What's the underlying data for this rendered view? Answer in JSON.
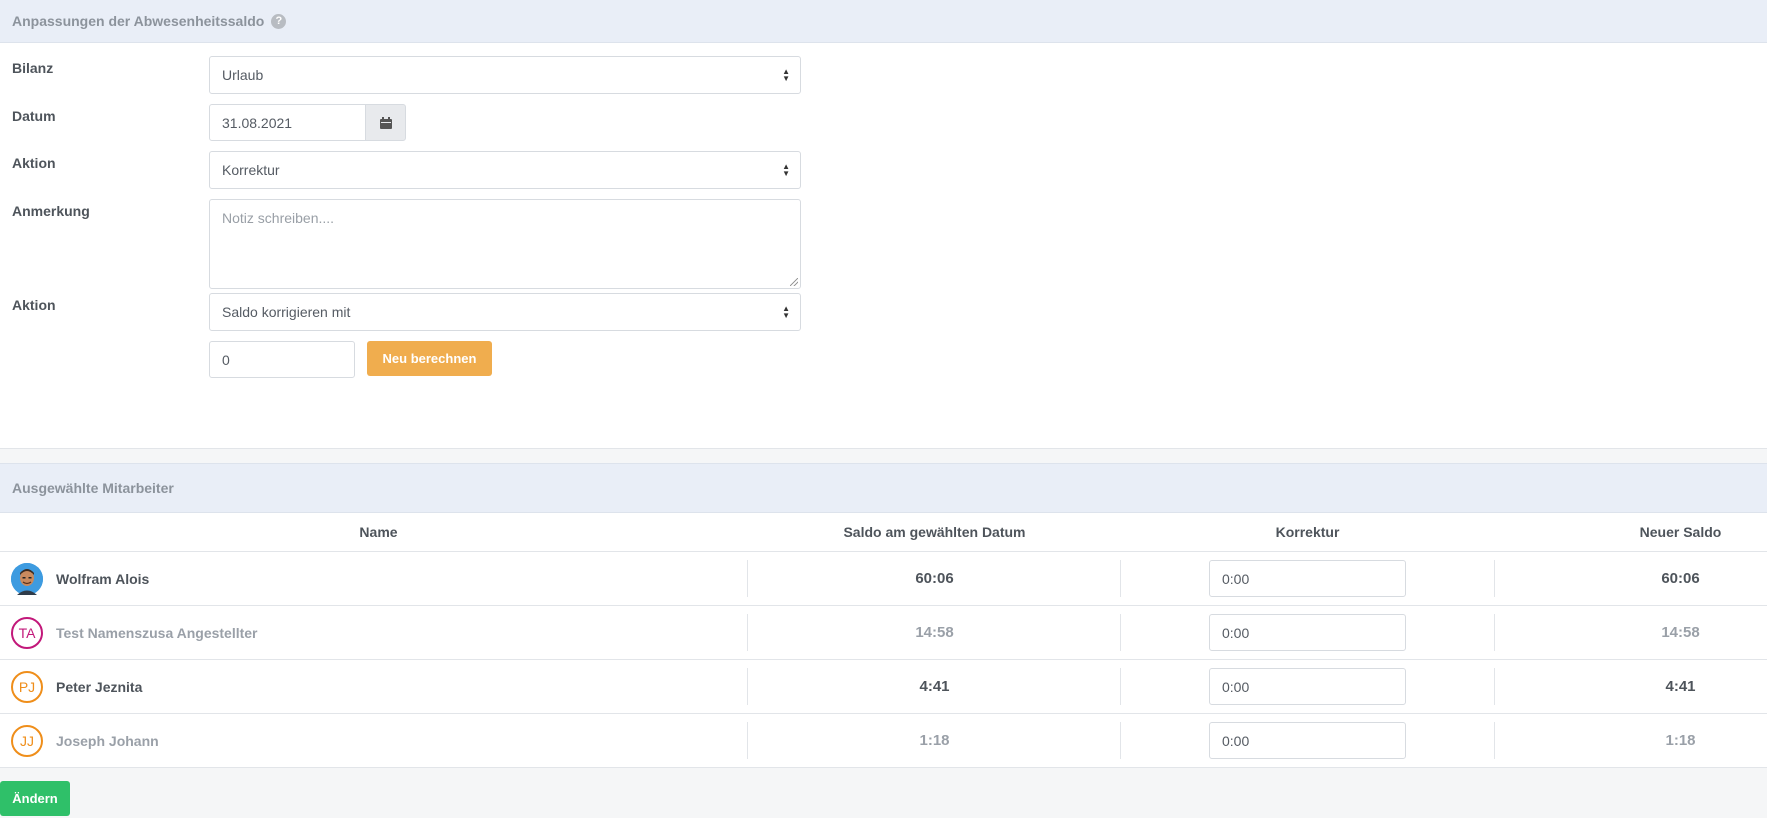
{
  "adjustments": {
    "title": "Anpassungen der Abwesenheitssaldo",
    "help_icon_glyph": "?",
    "fields": {
      "bilanz_label": "Bilanz",
      "bilanz_value": "Urlaub",
      "datum_label": "Datum",
      "datum_value": "31.08.2021",
      "aktion_label": "Aktion",
      "aktion_value": "Korrektur",
      "anmerkung_label": "Anmerkung",
      "anmerkung_placeholder": "Notiz schreiben....",
      "aktion2_label": "Aktion",
      "aktion2_value": "Saldo korrigieren mit",
      "amount_value": "0"
    },
    "recalc_button": "Neu berechnen"
  },
  "employees_section": {
    "title": "Ausgewählte Mitarbeiter",
    "columns": {
      "name": "Name",
      "saldo": "Saldo am gewählten Datum",
      "korrektur": "Korrektur",
      "neuer_saldo": "Neuer Saldo"
    },
    "rows": [
      {
        "name": "Wolfram Alois",
        "avatar_type": "photo",
        "initials": "",
        "avatar_color": "#3d9be0",
        "saldo": "60:06",
        "korrektur": "0:00",
        "neuer_saldo": "60:06",
        "active": true
      },
      {
        "name": "Test Namenszusa Angestellter",
        "avatar_type": "initials",
        "initials": "TA",
        "avatar_color": "#c2187a",
        "saldo": "14:58",
        "korrektur": "0:00",
        "neuer_saldo": "14:58",
        "active": false
      },
      {
        "name": "Peter Jeznita",
        "avatar_type": "initials",
        "initials": "PJ",
        "avatar_color": "#ef8e1a",
        "saldo": "4:41",
        "korrektur": "0:00",
        "neuer_saldo": "4:41",
        "active": true
      },
      {
        "name": "Joseph Johann",
        "avatar_type": "initials",
        "initials": "JJ",
        "avatar_color": "#ef8e1a",
        "saldo": "1:18",
        "korrektur": "0:00",
        "neuer_saldo": "1:18",
        "active": false
      }
    ]
  },
  "submit_button": "Ändern",
  "colors": {
    "header_bg": "#e9eef7",
    "orange_button": "#f0ad4e",
    "green_button": "#2fc069"
  }
}
